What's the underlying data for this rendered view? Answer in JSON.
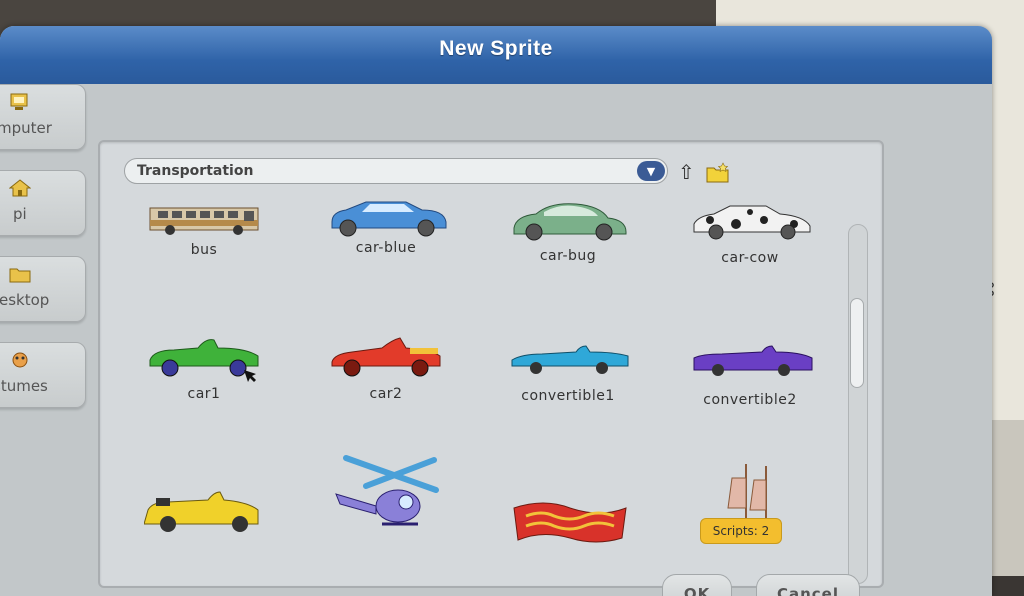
{
  "dialog": {
    "title": "New Sprite"
  },
  "sidebar": {
    "items": [
      {
        "label": "mputer",
        "icon": "computer-icon"
      },
      {
        "label": "pi",
        "icon": "home-icon"
      },
      {
        "label": "esktop",
        "icon": "folder-icon"
      },
      {
        "label": "stumes",
        "icon": "costumes-icon"
      }
    ]
  },
  "browser": {
    "path": "Transportation",
    "dropdown_icon": "▼",
    "up_icon": "⇧",
    "items": [
      {
        "name": "bus",
        "icon": "bus-icon",
        "color": "#b58a4a"
      },
      {
        "name": "car-blue",
        "icon": "car-blue-icon",
        "color": "#4a8fd6"
      },
      {
        "name": "car-bug",
        "icon": "car-bug-icon",
        "color": "#7bb08a"
      },
      {
        "name": "car-cow",
        "icon": "car-cow-icon",
        "color": "#f2f2f2"
      },
      {
        "name": "car1",
        "icon": "car1-icon",
        "color": "#3fb23a"
      },
      {
        "name": "car2",
        "icon": "car2-icon",
        "color": "#e23b2a"
      },
      {
        "name": "convertible1",
        "icon": "convertible1-icon",
        "color": "#2fa8d8"
      },
      {
        "name": "convertible2",
        "icon": "convertible2-icon",
        "color": "#6a3fc4"
      },
      {
        "name": "",
        "icon": "convertible-yellow-icon",
        "color": "#f0d12a"
      },
      {
        "name": "",
        "icon": "helicopter-icon",
        "color": "#6a9ee0"
      },
      {
        "name": "",
        "icon": "magic-carpet-icon",
        "color": "#d8322a"
      },
      {
        "name": "",
        "icon": "sailboat-icon",
        "color": "#d8b0a0"
      }
    ],
    "tooltip": "Scripts: 2"
  },
  "footer": {
    "ok_label": "OK",
    "cancel_label": "Cancel"
  }
}
